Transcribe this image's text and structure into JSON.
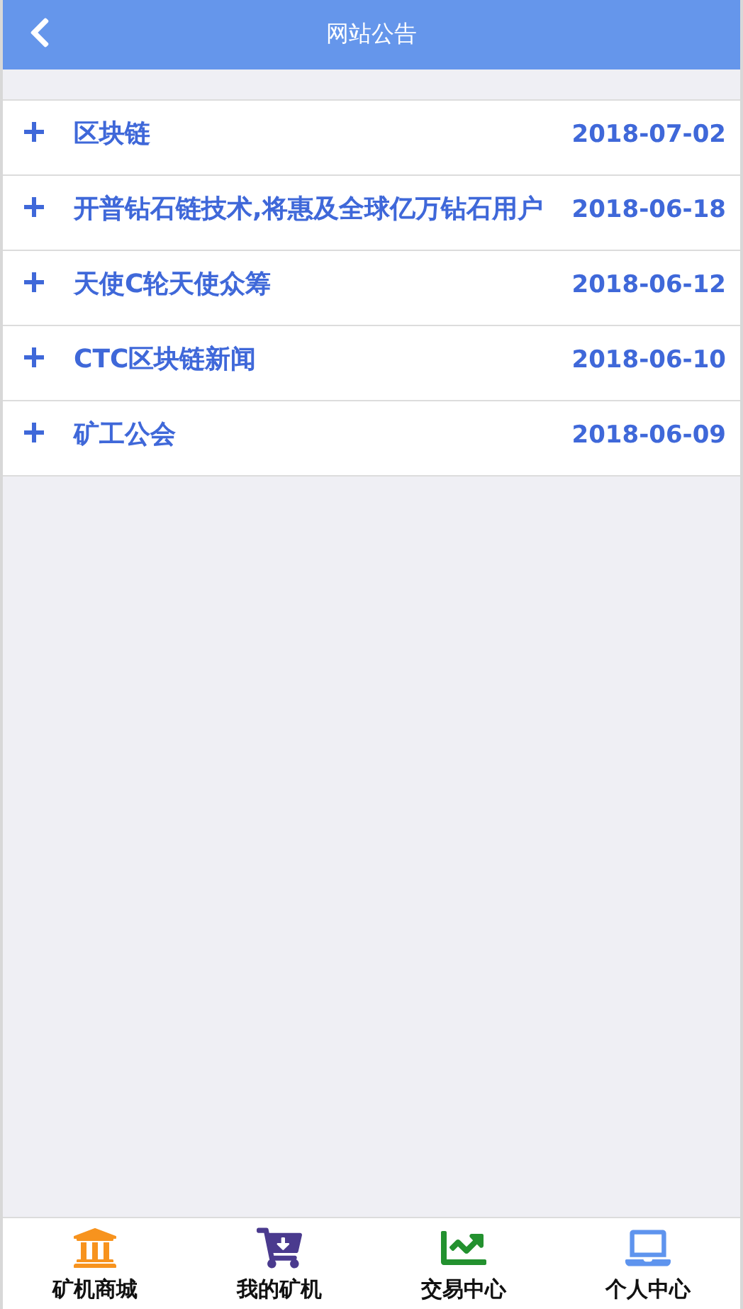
{
  "header": {
    "title": "网站公告"
  },
  "notices": [
    {
      "title": "区块链",
      "date": "2018-07-02"
    },
    {
      "title": "开普钻石链技术,将惠及全球亿万钻石用户",
      "date": "2018-06-18"
    },
    {
      "title": "天使C轮天使众筹",
      "date": "2018-06-12"
    },
    {
      "title": "CTC区块链新闻",
      "date": "2018-06-10"
    },
    {
      "title": "矿工公会",
      "date": "2018-06-09"
    }
  ],
  "tab_bar": [
    {
      "label": "矿机商城",
      "color": "#f7931e"
    },
    {
      "label": "我的矿机",
      "color": "#4a3a8e"
    },
    {
      "label": "交易中心",
      "color": "#23912f"
    },
    {
      "label": "个人中心",
      "color": "#5e94ee"
    }
  ]
}
